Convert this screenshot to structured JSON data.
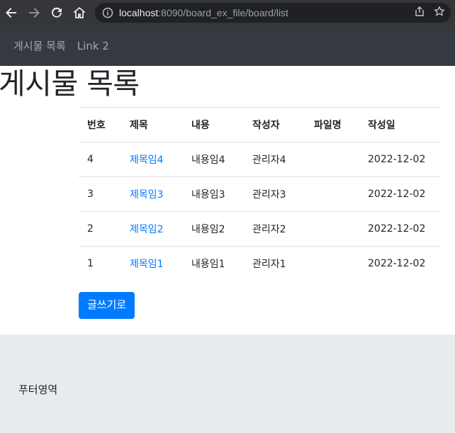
{
  "browser": {
    "url_host": "localhost",
    "url_rest": ":8090/board_ex_file/board/list"
  },
  "navbar": {
    "links": [
      "게시물 목록",
      "Link 2"
    ]
  },
  "main": {
    "title": "게시물 목록",
    "table": {
      "headers": [
        "번호",
        "제목",
        "내용",
        "작성자",
        "파일명",
        "작성일"
      ],
      "rows": [
        {
          "no": "4",
          "title": "제목임4",
          "content": "내용임4",
          "writer": "관리자4",
          "file": "",
          "date": "2022-12-02"
        },
        {
          "no": "3",
          "title": "제목임3",
          "content": "내용임3",
          "writer": "관리자3",
          "file": "",
          "date": "2022-12-02"
        },
        {
          "no": "2",
          "title": "제목임2",
          "content": "내용임2",
          "writer": "관리자2",
          "file": "",
          "date": "2022-12-02"
        },
        {
          "no": "1",
          "title": "제목임1",
          "content": "내용임1",
          "writer": "관리자1",
          "file": "",
          "date": "2022-12-02"
        }
      ]
    },
    "write_button": "글쓰기로"
  },
  "footer": {
    "text": "푸터영역"
  },
  "colors": {
    "navbar_bg": "#343a40",
    "link": "#007bff",
    "button_bg": "#007bff",
    "footer_bg": "#e9ecef"
  }
}
